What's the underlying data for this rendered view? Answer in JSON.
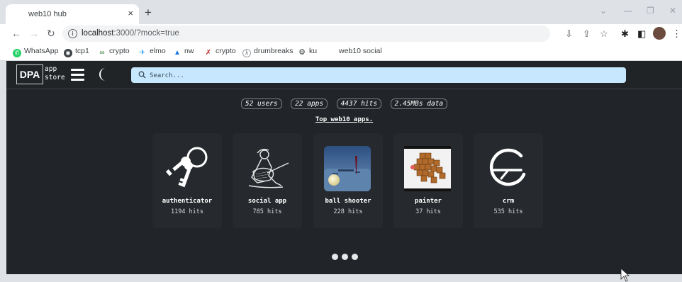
{
  "browser": {
    "tab_title": "web10 hub",
    "tab_close": "×",
    "new_tab": "+",
    "url_host": "localhost",
    "url_rest": ":3000/?mock=true",
    "bookmarks": [
      "WhatsApp",
      "tcp1",
      "crypto",
      "elmo",
      "nw",
      "crypto",
      "drumbreaks",
      "ku",
      "web10 social"
    ]
  },
  "app": {
    "logo": "DPA",
    "logo_line1": "app",
    "logo_line2": "store",
    "search_placeholder": "Search...",
    "stats": [
      "52 users",
      "22 apps",
      "4437 hits",
      "2.45MBs data"
    ],
    "top_link": "Top web10 apps.",
    "cards": [
      {
        "name": "authenticator",
        "hits": "1194 hits",
        "icon": "keys-icon"
      },
      {
        "name": "social app",
        "hits": "785 hits",
        "icon": "guitarist-icon"
      },
      {
        "name": "ball shooter",
        "hits": "228 hits",
        "icon": "ball-shooter-thumbnail"
      },
      {
        "name": "painter",
        "hits": "37 hits",
        "icon": "painter-thumbnail"
      },
      {
        "name": "crm",
        "hits": "535 hits",
        "icon": "crm-logo-icon"
      }
    ]
  },
  "colors": {
    "app_background": "#212529",
    "search_background": "#c6e7fd",
    "card_background": "#262a2e"
  }
}
